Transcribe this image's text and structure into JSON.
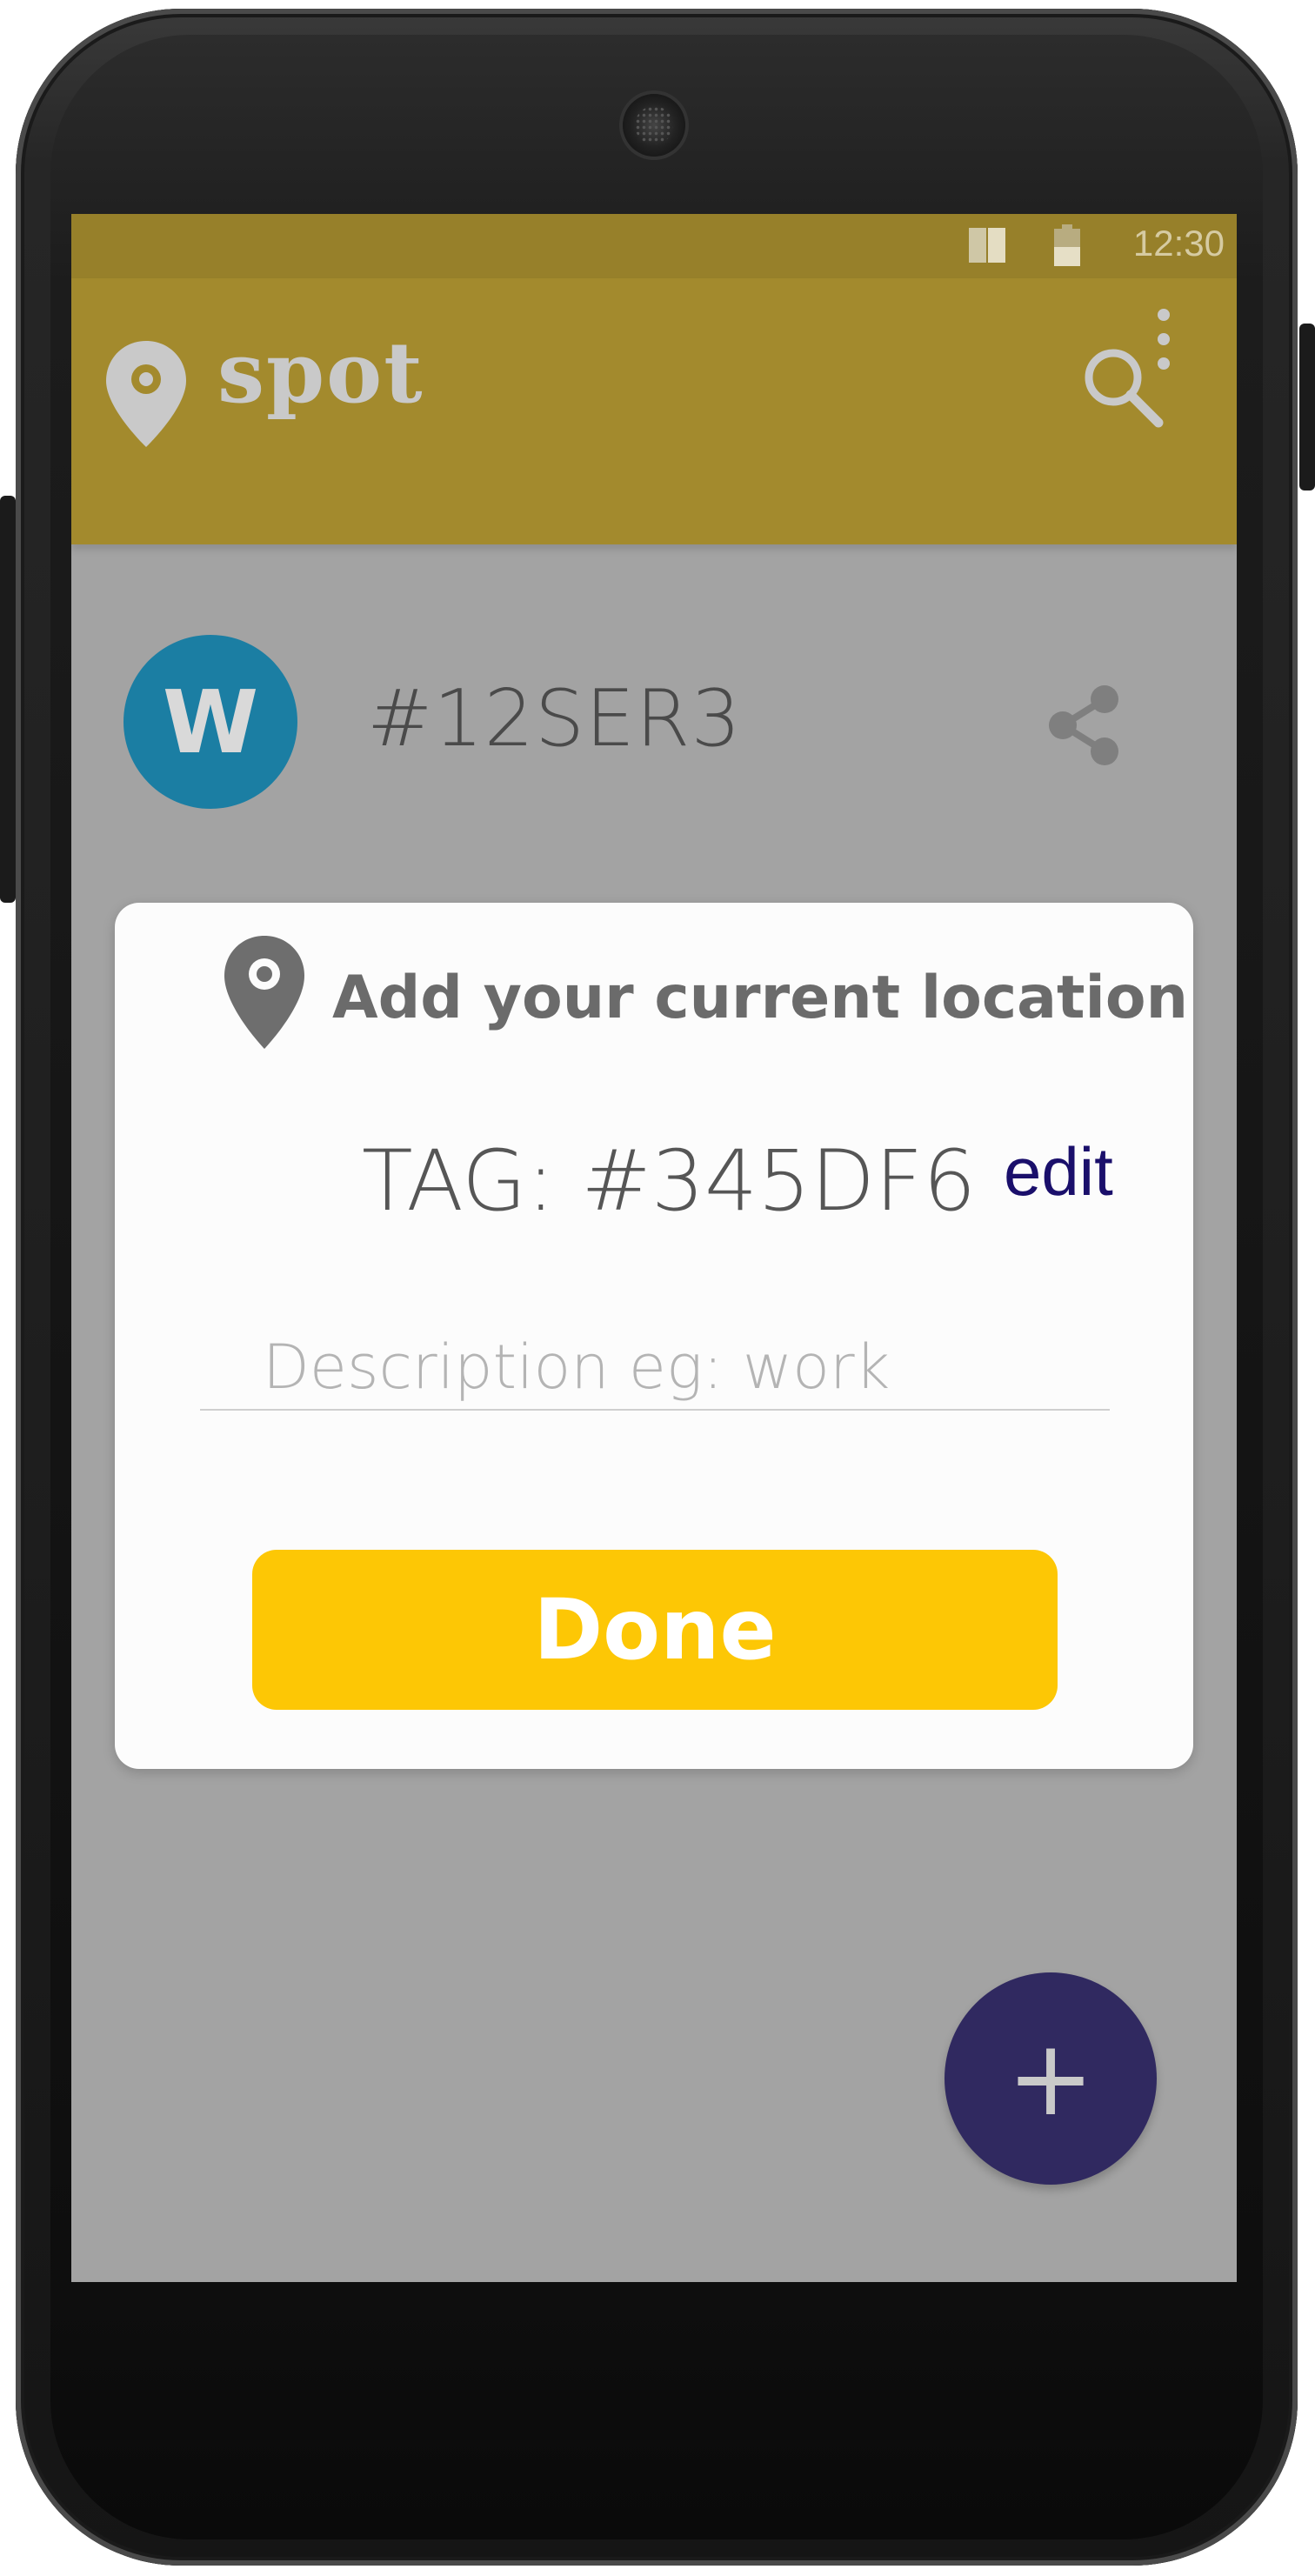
{
  "status_bar": {
    "time": "12:30",
    "signal_icon": "signal-icon",
    "battery_icon": "battery-icon"
  },
  "app_bar": {
    "logo_icon": "location-pin-icon",
    "app_name": "spot",
    "search_icon": "search-icon",
    "overflow_icon": "more-vert-icon",
    "background_color": "#a38a2d"
  },
  "list": {
    "items": [
      {
        "avatar_letter": "W",
        "avatar_color": "#1b7ea3",
        "tag": "#12SER3",
        "action_icon": "share-icon"
      }
    ]
  },
  "dialog": {
    "icon": "location-pin-icon",
    "title": "Add your current location",
    "tag_label": "TAG: #345DF6",
    "edit_label": "edit",
    "description": {
      "value": "",
      "placeholder": "Description eg: work"
    },
    "done_label": "Done",
    "done_color": "#fdc705"
  },
  "fab": {
    "label": "+",
    "color": "#302960"
  }
}
